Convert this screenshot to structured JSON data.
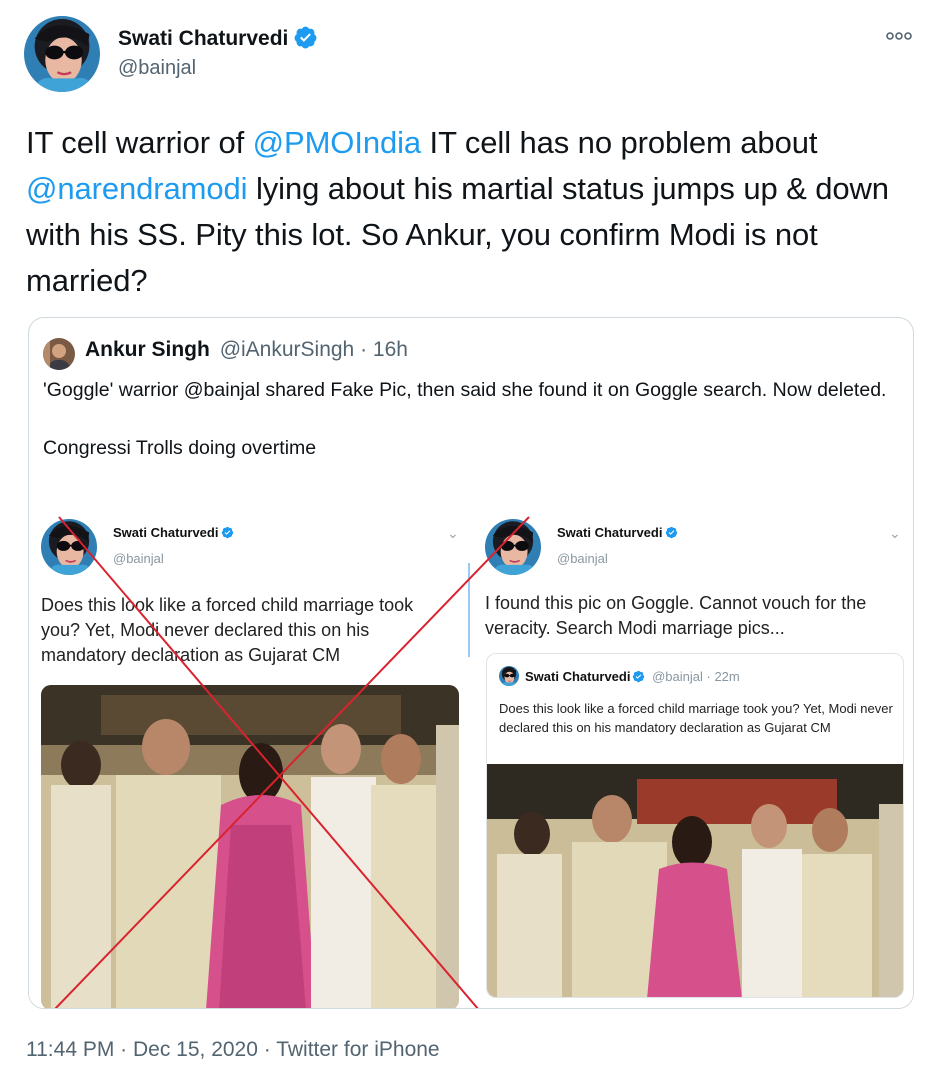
{
  "tweet": {
    "author_name": "Swati Chaturvedi",
    "author_handle": "@bainjal",
    "more_icon": "more-dots-icon",
    "verified_icon": "verified-badge-icon",
    "text_parts": {
      "p1": "IT cell warrior of ",
      "mention1": "@PMOIndia",
      "p2": " IT cell has no problem about ",
      "mention2": "@narendramodi",
      "p3": " lying about his martial status jumps up & down with his SS. Pity this lot. So Ankur, you confirm Modi is not married?"
    },
    "timestamp": "11:44 PM · Dec 15, 2020 · Twitter for iPhone"
  },
  "quoted_tweet": {
    "author_name": "Ankur Singh",
    "author_handle": "@iAnkurSingh",
    "age": "· 16h",
    "text_line1": "'Goggle' warrior @bainjal shared Fake Pic, then said she found it on Goggle search. Now deleted.",
    "text_line2": "Congressi Trolls doing overtime"
  },
  "embedded_left": {
    "name": "Swati Chaturvedi",
    "handle": "@bainjal",
    "text": "Does this look like a forced child marriage took you? Yet, Modi never declared this on his mandatory declaration as Gujarat CM"
  },
  "embedded_right": {
    "name": "Swati Chaturvedi",
    "handle": "@bainjal",
    "text": "I found this pic on Goggle. Cannot vouch for the veracity. Search Modi marriage pics...",
    "inner": {
      "name": "Swati Chaturvedi",
      "handle": "@bainjal",
      "age": "· 22m",
      "text": "Does this look like a forced child marriage took you? Yet, Modi never declared this on his mandatory declaration as Gujarat CM"
    }
  },
  "colors": {
    "link": "#1d9bf0",
    "muted": "#536471",
    "cross_mark": "#d9232e",
    "card_border": "#cfd9de"
  }
}
